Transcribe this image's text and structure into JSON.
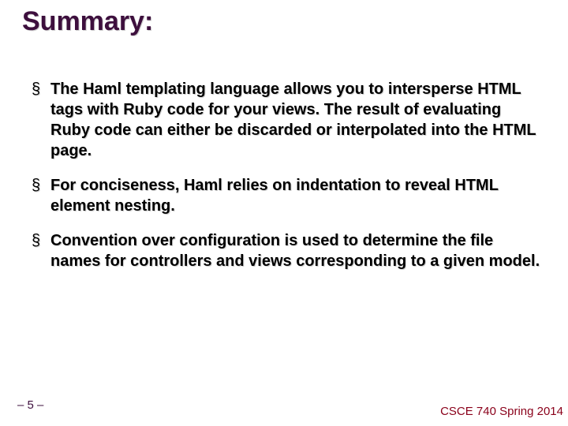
{
  "title": "Summary:",
  "bullets": [
    "The Haml templating language allows you to intersperse HTML tags with Ruby code for your views. The result of evaluating Ruby code can either be discarded or interpolated into the HTML page.",
    "For conciseness, Haml relies on indentation to reveal HTML element nesting.",
    "Convention over configuration is used to determine the file names for controllers and views corresponding to a given model."
  ],
  "footer": {
    "left": "– 5 –",
    "right": "CSCE 740 Spring 2014"
  }
}
